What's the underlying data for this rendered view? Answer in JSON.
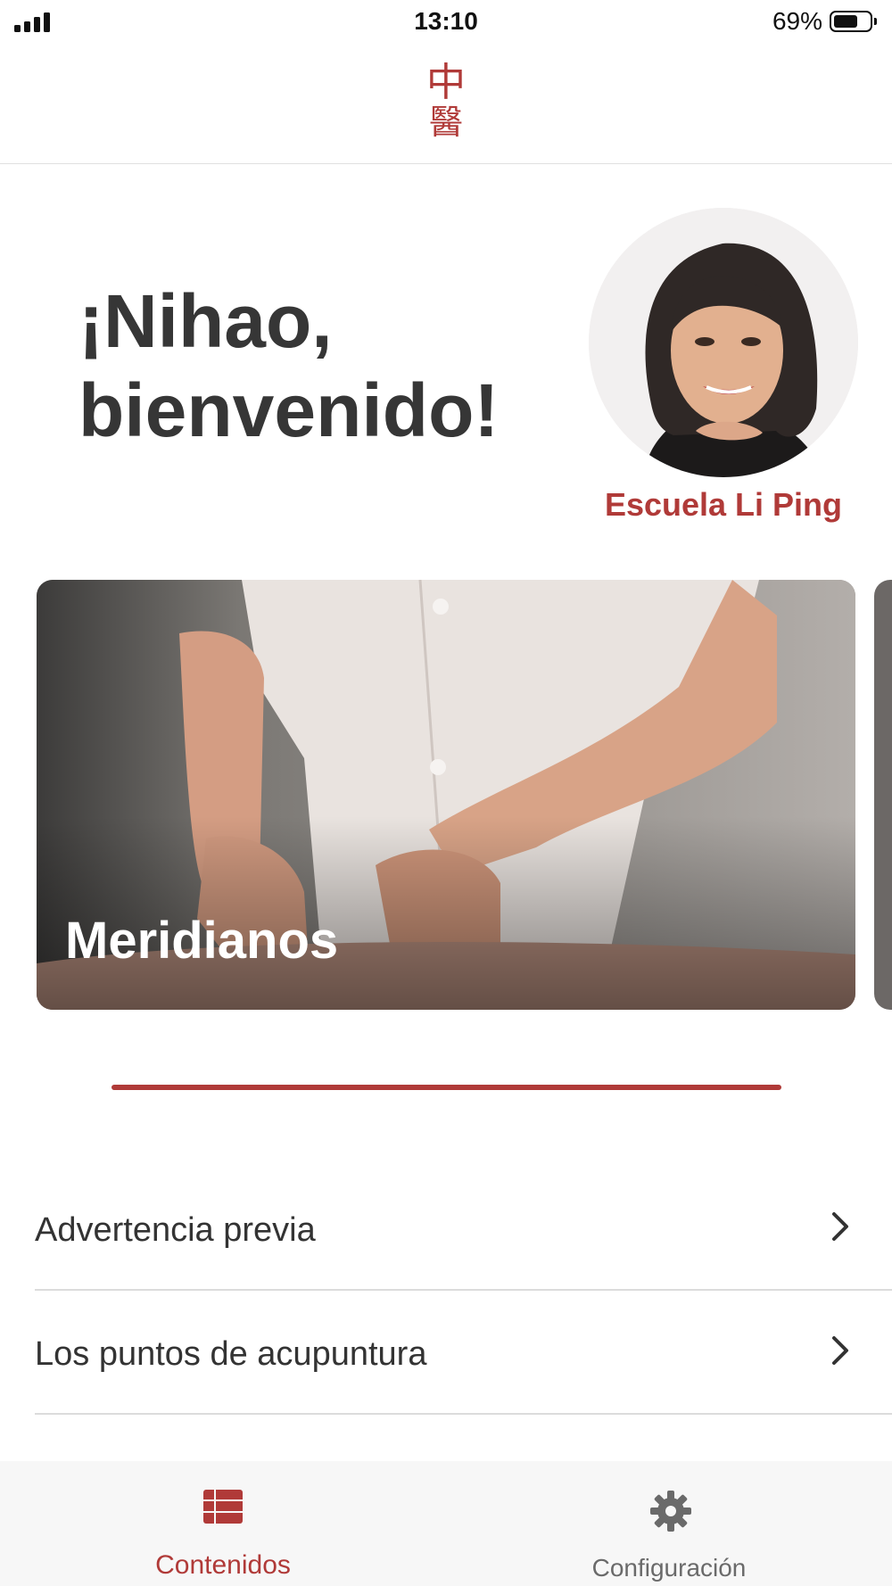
{
  "status_bar": {
    "time": "13:10",
    "battery_percent": "69%",
    "battery_level": 0.69
  },
  "header": {
    "logo_char_top": "中",
    "logo_char_bottom": "醫"
  },
  "greeting": {
    "line1": "¡Nihao,",
    "line2": "bienvenido!"
  },
  "profile": {
    "school_name": "Escuela Li Ping"
  },
  "carousel": {
    "cards": [
      {
        "title": "Meridianos"
      }
    ]
  },
  "list": {
    "items": [
      {
        "label": "Advertencia previa"
      },
      {
        "label": "Los puntos de acupuntura"
      }
    ]
  },
  "tab_bar": {
    "tabs": [
      {
        "label": "Contenidos",
        "active": true,
        "icon": "list-icon"
      },
      {
        "label": "Configuración",
        "active": false,
        "icon": "gear-icon"
      }
    ]
  },
  "colors": {
    "accent": "#b03a38",
    "text": "#333333",
    "divider": "#dcdcdc",
    "tab_bar_bg": "#f7f7f7"
  }
}
